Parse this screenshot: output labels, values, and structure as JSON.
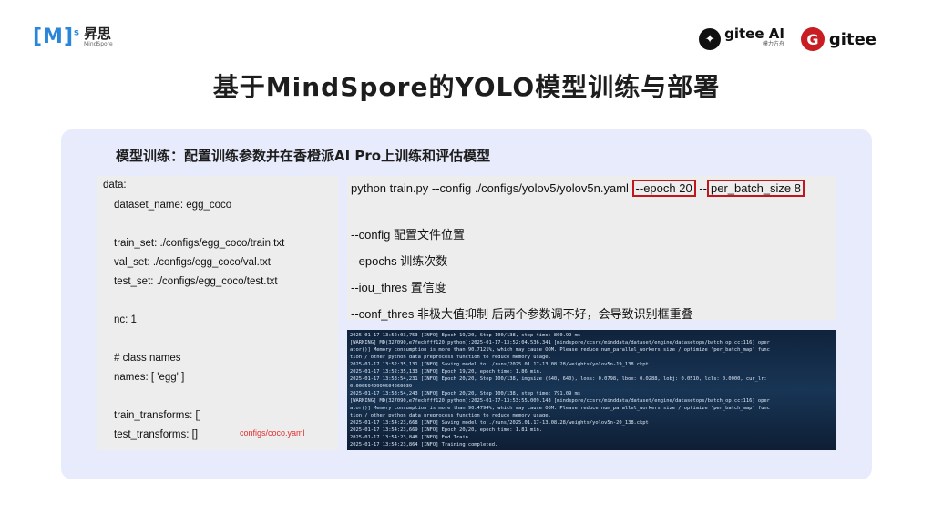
{
  "logo_left": {
    "mark": "[M]",
    "sup": "s",
    "cn": "昇思",
    "sub": "MindSpore"
  },
  "logo_right": {
    "gitee_ai": {
      "icon_char": "✦",
      "text": "gitee AI",
      "sub": "模力方舟"
    },
    "gitee": {
      "icon_char": "G",
      "text": "gitee"
    }
  },
  "title": "基于MindSpore的YOLO模型训练与部署",
  "subtitle": "模型训练：配置训练参数并在香橙派AI Pro上训练和评估模型",
  "config_lines": [
    "data:",
    "dataset_name: egg_coco",
    "train_set: ./configs/egg_coco/train.txt",
    "val_set: ./configs/egg_coco/val.txt",
    "test_set: ./configs/egg_coco/test.txt",
    "nc: 1",
    "# class names",
    "names: [ 'egg' ]",
    "train_transforms: []",
    "test_transforms: []"
  ],
  "config_note": "configs/coco.yaml",
  "command": {
    "prefix": "python train.py --config ./configs/yolov5/yolov5n.yaml ",
    "epoch": "--epoch 20",
    "sep": " --",
    "batch": "per_batch_size 8"
  },
  "options": [
    "--config  配置文件位置",
    "--epochs  训练次数",
    "--iou_thres  置信度",
    "--conf_thres  非极大值抑制  后两个参数调不好，会导致识别框重叠"
  ],
  "terminal_lines": [
    "2025-01-17 13:52:03,753 [INFO] Epoch 19/20, Step 100/138, step time: 800.99 ms",
    "[WARNING] MD(327090,e7fecbfff120,python):2025-01-17-13:52:04.536.341 [mindspore/ccsrc/minddata/dataset/engine/datasetops/batch_op.cc:116] oper",
    "ator()] Memory consumption is more than 90.7121%, which may cause OOM. Please reduce num_parallel_workers size / optimize 'per_batch_map' func",
    "tion / other python data preprocess function to reduce memory usage.",
    "2025-01-17 13:52:35,131 [INFO] Saving model to ./runs/2025.01.17-13.08.28/weights/yolov5n-19_138.ckpt",
    "2025-01-17 13:52:35,133 [INFO] Epoch 19/20, epoch time: 1.86 min.",
    "2025-01-17 13:53:54,231 [INFO] Epoch 20/20, Step 100/138, imgsize (640, 640), loss: 0.0798, lbox: 0.0288, lobj: 0.0510, lcls: 0.0000, cur_lr:",
    "0.0005949999504260039",
    "2025-01-17 13:53:54,243 [INFO] Epoch 20/20, Step 100/138, step time: 791.09 ms",
    "[WARNING] MD(327090,e7fecbfff120,python):2025-01-17-13:53:55.009.143 [mindspore/ccsrc/minddata/dataset/engine/datasetops/batch_op.cc:116] oper",
    "ator()] Memory consumption is more than 90.4794%, which may cause OOM. Please reduce num_parallel_workers size / optimize 'per_batch_map' func",
    "tion / other python data preprocess function to reduce memory usage.",
    "2025-01-17 13:54:23,668 [INFO] Saving model to ./runs/2025.01.17-13.08.28/weights/yolov5n-20_138.ckpt",
    "2025-01-17 13:54:23,669 [INFO] Epoch 20/20, epoch time: 1.81 min.",
    "2025-01-17 13:54:23,848 [INFO] End Train.",
    "2025-01-17 13:54:23,864 [INFO] Training completed."
  ]
}
